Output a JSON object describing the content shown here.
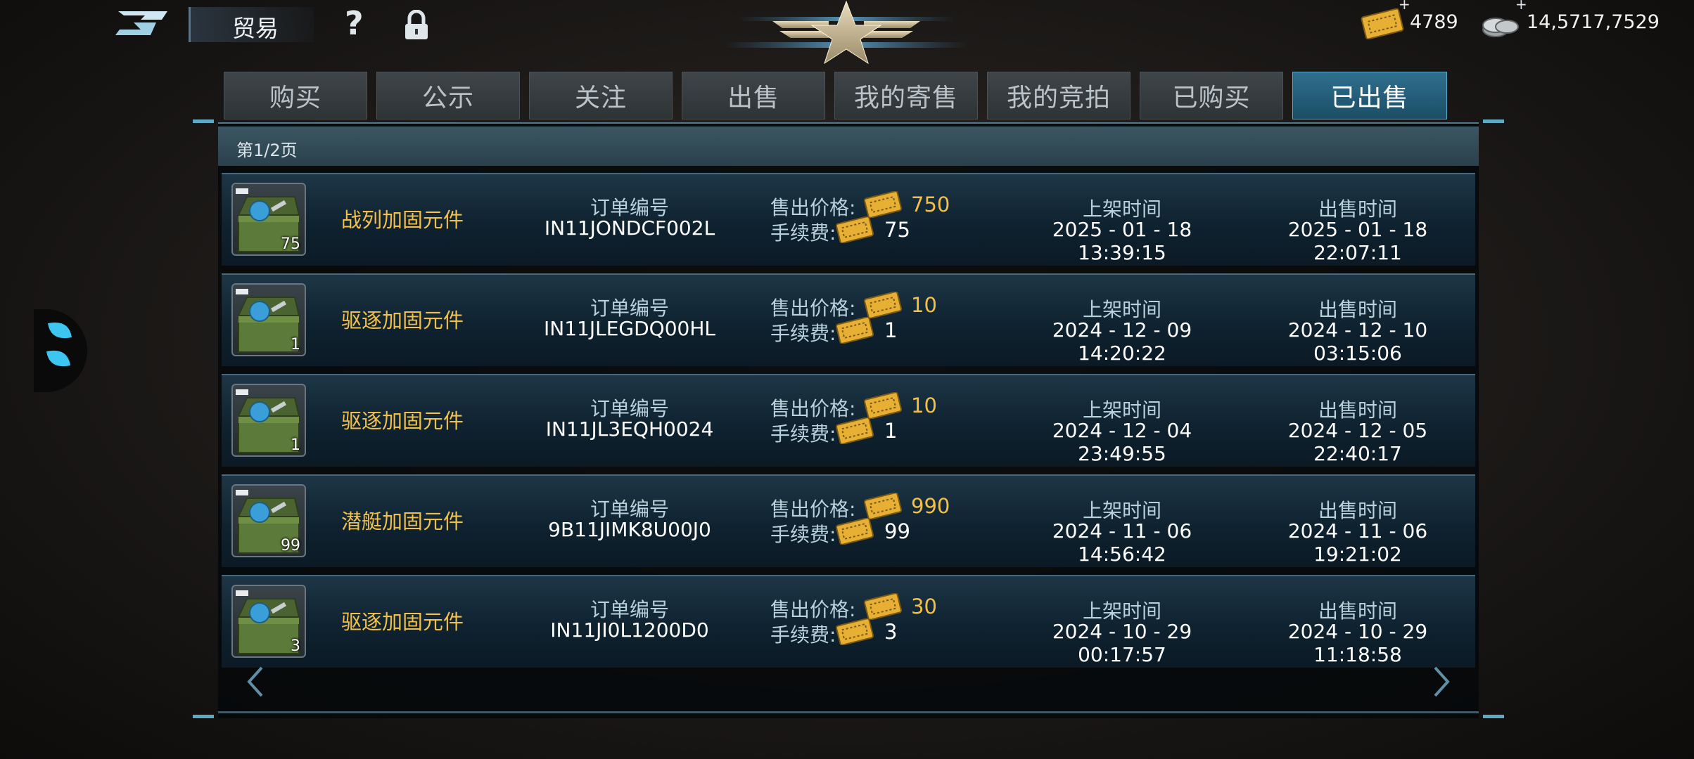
{
  "header": {
    "title": "贸易",
    "help_icon": "question-icon",
    "help_glyph": "?",
    "lock_icon": "lock-icon",
    "currency1": {
      "icon": "ticket-icon",
      "value": "4789",
      "plus": "+"
    },
    "currency2": {
      "icon": "silver-coins-icon",
      "value": "14,5717,7529",
      "plus": "+"
    }
  },
  "tabs": [
    {
      "label": "购买",
      "active": false
    },
    {
      "label": "公示",
      "active": false
    },
    {
      "label": "关注",
      "active": false
    },
    {
      "label": "出售",
      "active": false
    },
    {
      "label": "我的寄售",
      "active": false
    },
    {
      "label": "我的竞拍",
      "active": false
    },
    {
      "label": "已购买",
      "active": false
    },
    {
      "label": "已出售",
      "active": true
    }
  ],
  "page_indicator": "第1/2页",
  "columns": {
    "order_label": "订单编号",
    "price_label": "售出价格:",
    "fee_label": "手续费:",
    "list_time_label": "上架时间",
    "sold_time_label": "出售时间"
  },
  "rows": [
    {
      "name": "战列加固元件",
      "qty": "75",
      "order_no": "IN11JONDCF002L",
      "price": "750",
      "fee": "75",
      "list_time": "2025 - 01 - 18 13:39:15",
      "sold_time": "2025 - 01 - 18 22:07:11"
    },
    {
      "name": "驱逐加固元件",
      "qty": "1",
      "order_no": "IN11JLEGDQ00HL",
      "price": "10",
      "fee": "1",
      "list_time": "2024 - 12 - 09 14:20:22",
      "sold_time": "2024 - 12 - 10 03:15:06"
    },
    {
      "name": "驱逐加固元件",
      "qty": "1",
      "order_no": "IN11JL3EQH0024",
      "price": "10",
      "fee": "1",
      "list_time": "2024 - 12 - 04 23:49:55",
      "sold_time": "2024 - 12 - 05 22:40:17"
    },
    {
      "name": "潜艇加固元件",
      "qty": "99",
      "order_no": "9B11JIMK8U00J0",
      "price": "990",
      "fee": "99",
      "list_time": "2024 - 11 - 06 14:56:42",
      "sold_time": "2024 - 11 - 06 19:21:02"
    },
    {
      "name": "驱逐加固元件",
      "qty": "3",
      "order_no": "IN11JI0L1200D0",
      "price": "30",
      "fee": "3",
      "list_time": "2024 - 10 - 29 00:17:57",
      "sold_time": "2024 - 10 - 29 11:18:58"
    }
  ],
  "nav": {
    "prev_icon": "chevron-left-icon",
    "next_icon": "chevron-right-icon"
  },
  "colors": {
    "accent": "#2f6f8e",
    "gold": "#f2c04a",
    "label": "#b8d2dc"
  }
}
